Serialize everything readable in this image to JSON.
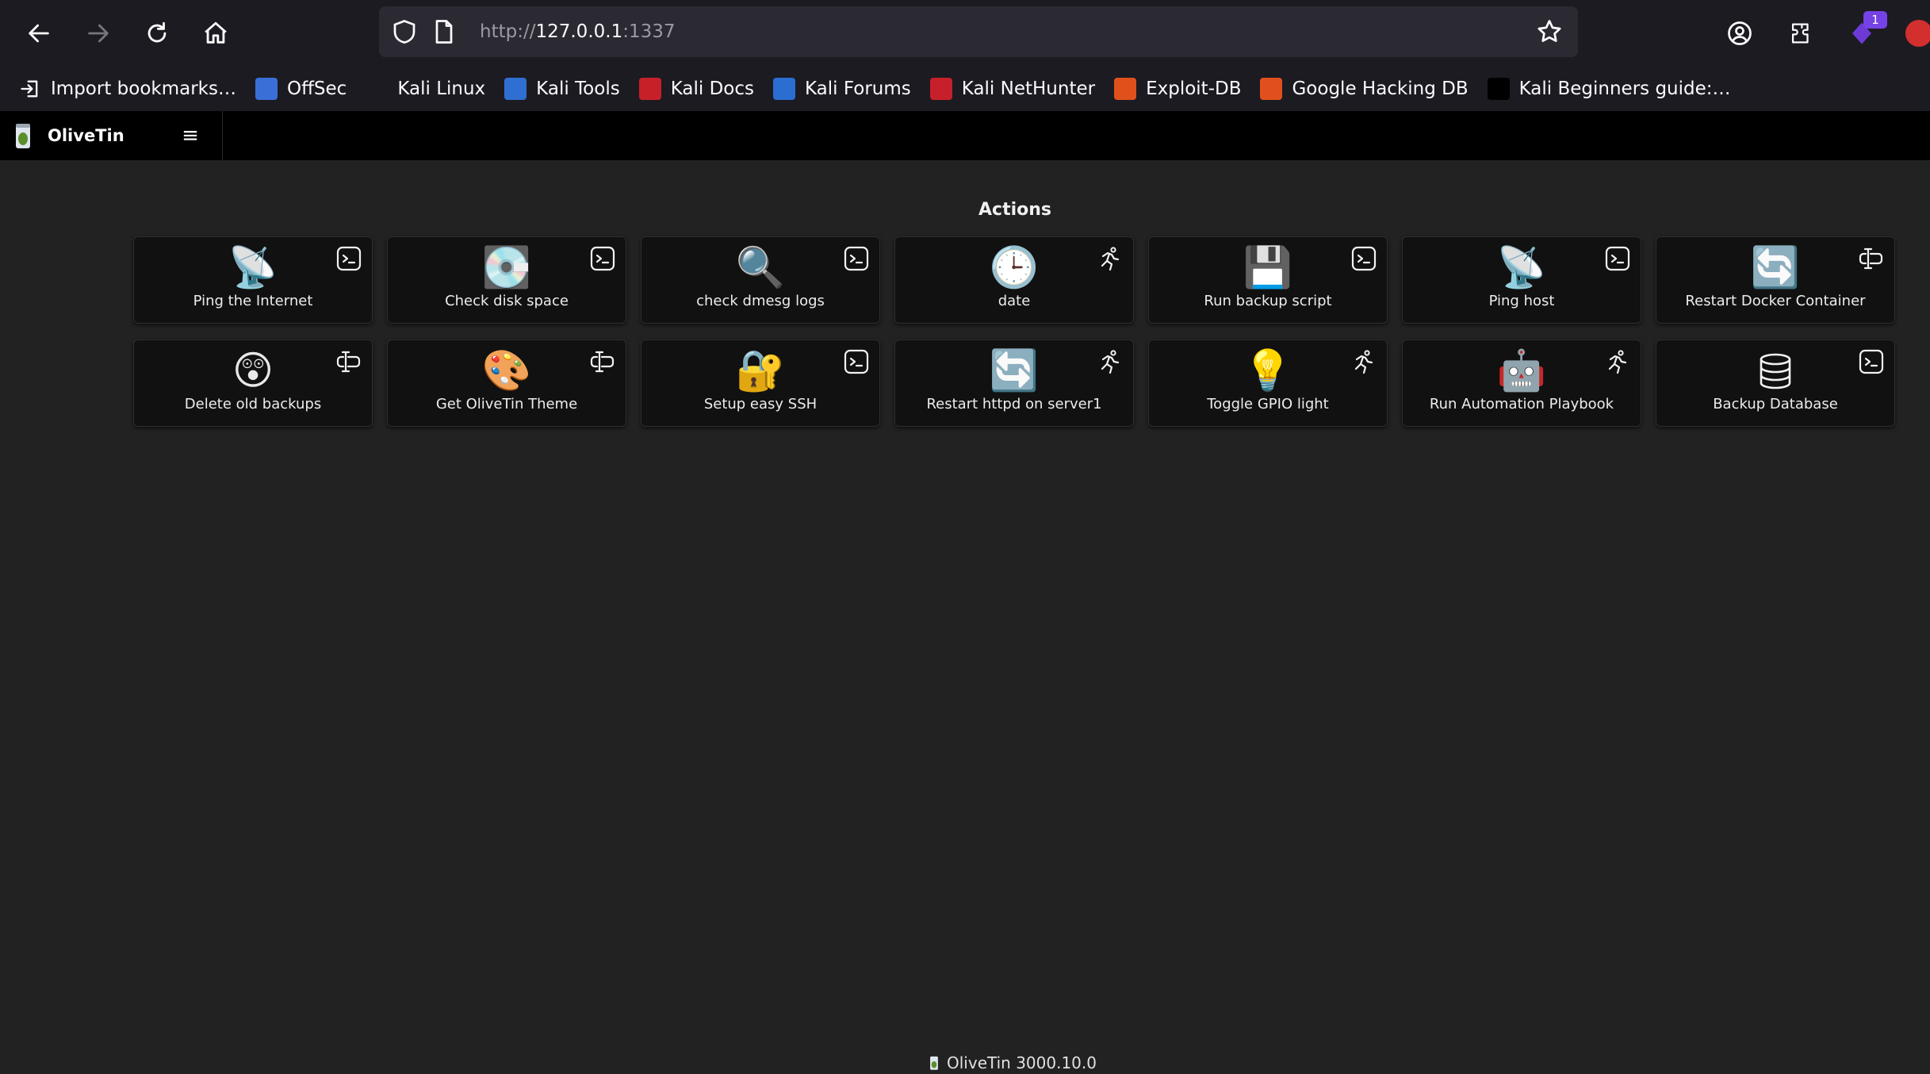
{
  "browser": {
    "url_prefix": "http://",
    "url_host": "127.0.0.1",
    "url_suffix": ":1337",
    "extension_badge": "1",
    "bookmarks": [
      {
        "label": "Import bookmarks…",
        "icon": "import-icon",
        "color": "#1c1b22"
      },
      {
        "label": "OffSec",
        "icon": "offsec-icon",
        "color": "#3b6fd8"
      },
      {
        "label": "Kali Linux",
        "icon": "kali-dragon-icon",
        "color": "#1c1b22"
      },
      {
        "label": "Kali Tools",
        "icon": "kali-tools-icon",
        "color": "#2f6fd1"
      },
      {
        "label": "Kali Docs",
        "icon": "kali-docs-icon",
        "color": "#c8202a"
      },
      {
        "label": "Kali Forums",
        "icon": "kali-forums-icon",
        "color": "#2a6ed1"
      },
      {
        "label": "Kali NetHunter",
        "icon": "nethunter-icon",
        "color": "#c8202a"
      },
      {
        "label": "Exploit-DB",
        "icon": "exploit-db-icon",
        "color": "#e0501c"
      },
      {
        "label": "Google Hacking DB",
        "icon": "ghdb-icon",
        "color": "#e0501c"
      },
      {
        "label": "Kali Beginners guide:…",
        "icon": "medium-icon",
        "color": "#000000"
      }
    ]
  },
  "app": {
    "name": "OliveTin",
    "section_title": "Actions",
    "footer": "OliveTin 3000.10.0",
    "actions": [
      {
        "label": "Ping the Internet",
        "emoji": "📡",
        "type_icon": "terminal-icon"
      },
      {
        "label": "Check disk space",
        "emoji": "💽",
        "type_icon": "terminal-icon"
      },
      {
        "label": "check dmesg logs",
        "emoji": "🔍",
        "type_icon": "terminal-icon"
      },
      {
        "label": "date",
        "emoji": "🕒",
        "type_icon": "running-icon"
      },
      {
        "label": "Run backup script",
        "emoji": "💾",
        "type_icon": "terminal-icon"
      },
      {
        "label": "Ping host",
        "emoji": "📡",
        "type_icon": "terminal-icon"
      },
      {
        "label": "Restart Docker Container",
        "emoji": "🔄",
        "type_icon": "input-icon"
      },
      {
        "label": "Delete old backups",
        "emoji": "😲",
        "type_icon": "input-icon"
      },
      {
        "label": "Get OliveTin Theme",
        "emoji": "🎨",
        "type_icon": "input-icon"
      },
      {
        "label": "Setup easy SSH",
        "emoji": "🔐",
        "type_icon": "terminal-icon"
      },
      {
        "label": "Restart httpd on server1",
        "emoji": "🔄",
        "type_icon": "running-icon"
      },
      {
        "label": "Toggle GPIO light",
        "emoji": "💡",
        "type_icon": "running-icon"
      },
      {
        "label": "Run Automation Playbook",
        "emoji": "🤖",
        "type_icon": "running-icon"
      },
      {
        "label": "Backup Database",
        "emoji": "",
        "type_icon": "terminal-icon",
        "icon_name": "database-icon"
      }
    ]
  }
}
